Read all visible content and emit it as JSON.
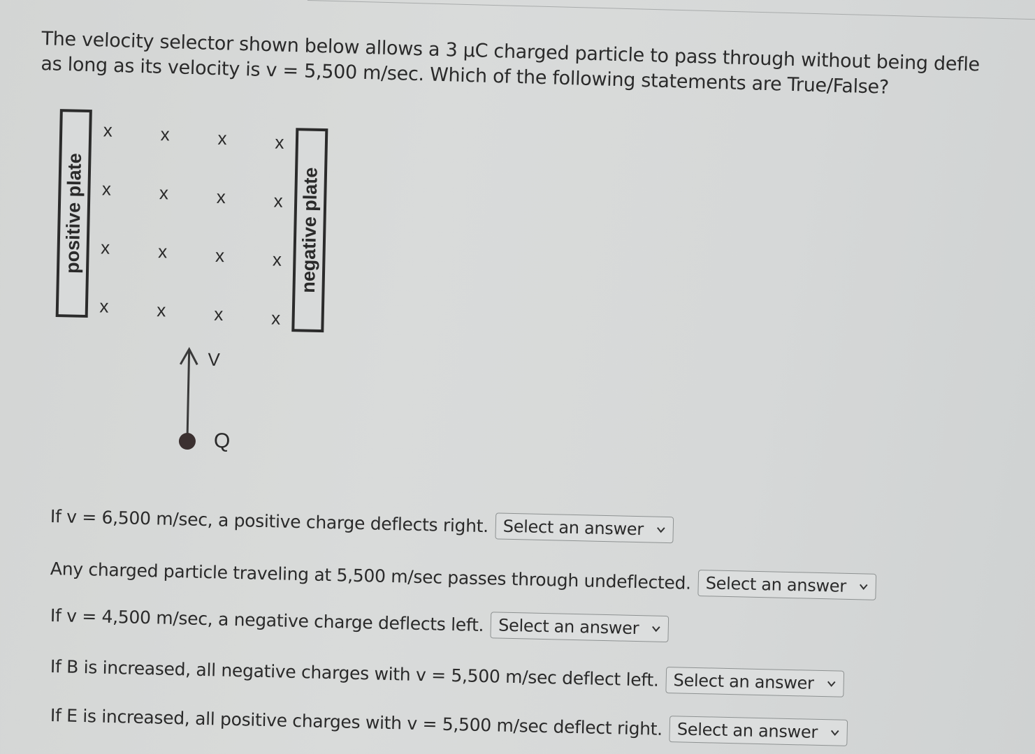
{
  "question": {
    "line1": "The velocity selector shown below allows a 3 μC charged particle to pass through without being defle",
    "line2": "as long as its velocity is v = 5,500 m/sec. Which of the following statements are True/False?"
  },
  "diagram": {
    "positive_plate_label": "positive plate",
    "negative_plate_label": "negative plate",
    "field_symbol": "x",
    "field_rows": 4,
    "field_cols": 4,
    "velocity_label": "V",
    "charge_label": "Q"
  },
  "statements": [
    {
      "text": "If v = 6,500 m/sec, a positive charge deflects right.",
      "select_value": "Select an answer"
    },
    {
      "text": "Any charged particle traveling at 5,500 m/sec passes through undeflected.",
      "select_value": "Select an answer"
    },
    {
      "text": "If v = 4,500 m/sec, a negative charge deflects left.",
      "select_value": "Select an answer"
    },
    {
      "text": "If B is increased, all negative charges with v = 5,500 m/sec deflect left.",
      "select_value": "Select an answer"
    },
    {
      "text": "If E is increased, all positive charges with v = 5,500 m/sec deflect right.",
      "select_value": "Select an answer"
    }
  ]
}
